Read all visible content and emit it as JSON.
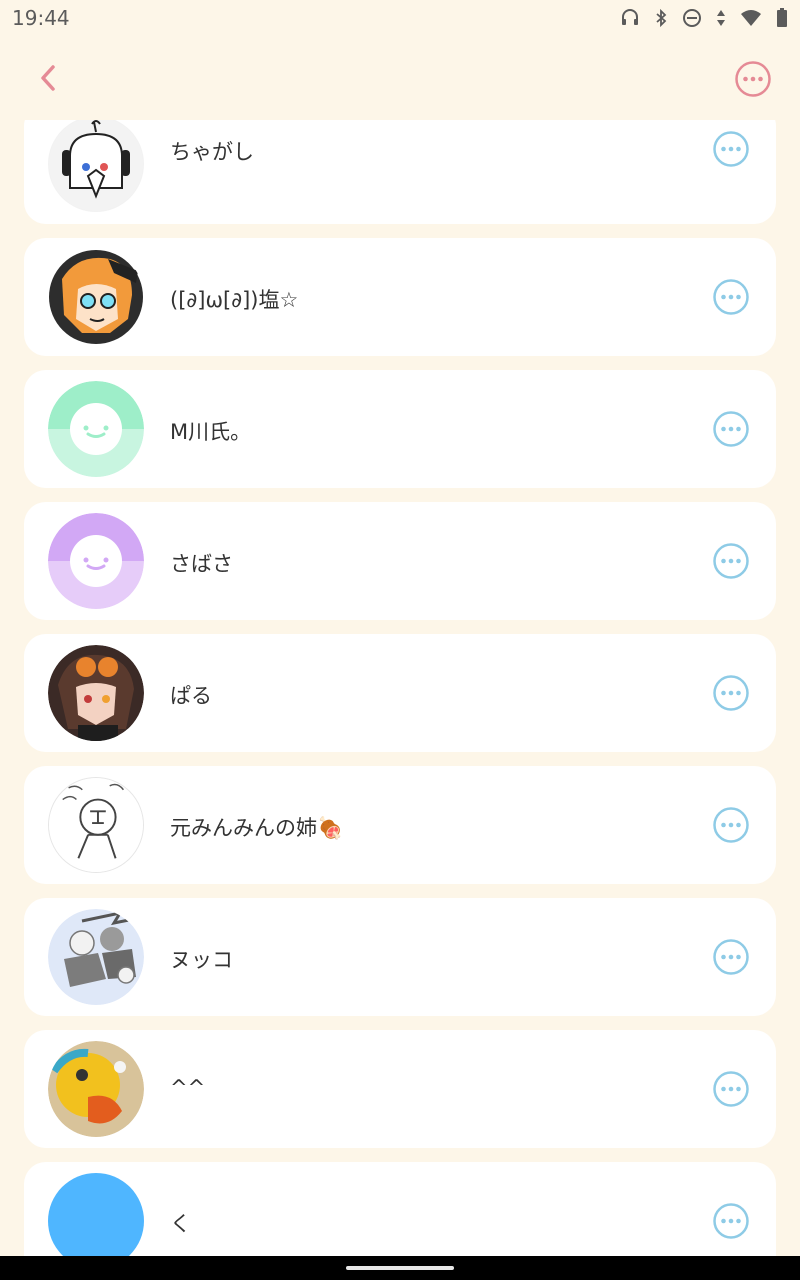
{
  "status_bar": {
    "time": "19:44",
    "icons": [
      "headphones-icon",
      "bluetooth-icon",
      "do-not-disturb-icon",
      "data-arrows-icon",
      "wifi-icon",
      "battery-icon"
    ]
  },
  "app_bar": {
    "back_icon": "chevron-left-icon",
    "more_icon": "more-horizontal-circle-icon",
    "accent_color": "#e58a95"
  },
  "list": {
    "row_more_color": "#8ecbe6",
    "items": [
      {
        "name": "ちゃがし",
        "avatar": "line-drawing-avatar"
      },
      {
        "name": "([∂]ω[∂])塩☆",
        "avatar": "orange-hair-avatar"
      },
      {
        "name": "M川氏。",
        "avatar": "default-mint-avatar"
      },
      {
        "name": "さばさ",
        "avatar": "default-purple-avatar"
      },
      {
        "name": "ぱる",
        "avatar": "goggles-avatar"
      },
      {
        "name": "元みんみんの姉🍖",
        "avatar": "sketch-avatar"
      },
      {
        "name": "ヌッコ",
        "avatar": "grey-sketch-avatar"
      },
      {
        "name": "^^",
        "avatar": "yellow-bird-avatar"
      },
      {
        "name": "く",
        "avatar": "blue-avatar"
      }
    ]
  }
}
